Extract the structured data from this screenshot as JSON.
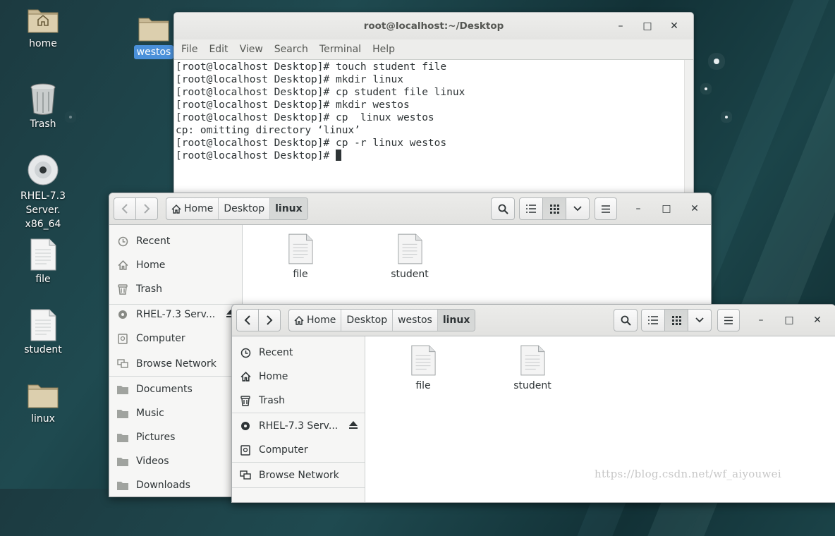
{
  "desktop": {
    "icons": [
      {
        "label": "home",
        "icon": "home-folder-icon"
      },
      {
        "label": "westos",
        "icon": "folder-icon"
      },
      {
        "label": "Trash",
        "icon": "trash-icon"
      },
      {
        "label_line1": "RHEL-7.3 Server.",
        "label_line2": "x86_64",
        "icon": "disc-icon"
      },
      {
        "label": "file",
        "icon": "document-icon"
      },
      {
        "label": "student",
        "icon": "document-icon"
      },
      {
        "label": "linux",
        "icon": "folder-icon"
      }
    ]
  },
  "terminal": {
    "title": "root@localhost:~/Desktop",
    "menu": [
      "File",
      "Edit",
      "View",
      "Search",
      "Terminal",
      "Help"
    ],
    "lines": [
      "[root@localhost Desktop]# touch student file",
      "[root@localhost Desktop]# mkdir linux",
      "[root@localhost Desktop]# cp student file linux",
      "[root@localhost Desktop]# mkdir westos",
      "[root@localhost Desktop]# cp  linux westos",
      "cp: omitting directory ‘linux’",
      "[root@localhost Desktop]# cp -r linux westos"
    ],
    "prompt": "[root@localhost Desktop]# "
  },
  "fm1": {
    "breadcrumb": [
      "Home",
      "Desktop",
      "linux"
    ],
    "sidebar": [
      "Recent",
      "Home",
      "Trash",
      "RHEL-7.3 Serv...",
      "Computer",
      "Browse Network",
      "Documents",
      "Music",
      "Pictures",
      "Videos",
      "Downloads"
    ],
    "files": [
      "file",
      "student"
    ]
  },
  "fm2": {
    "breadcrumb": [
      "Home",
      "Desktop",
      "westos",
      "linux"
    ],
    "sidebar": [
      "Recent",
      "Home",
      "Trash",
      "RHEL-7.3 Serv...",
      "Computer",
      "Browse Network"
    ],
    "files": [
      "file",
      "student"
    ]
  },
  "watermark": "https://blog.csdn.net/wf_aiyouwei",
  "colors": {
    "selection": "#4a90d9",
    "desktop_bg": "#1c3a40"
  }
}
